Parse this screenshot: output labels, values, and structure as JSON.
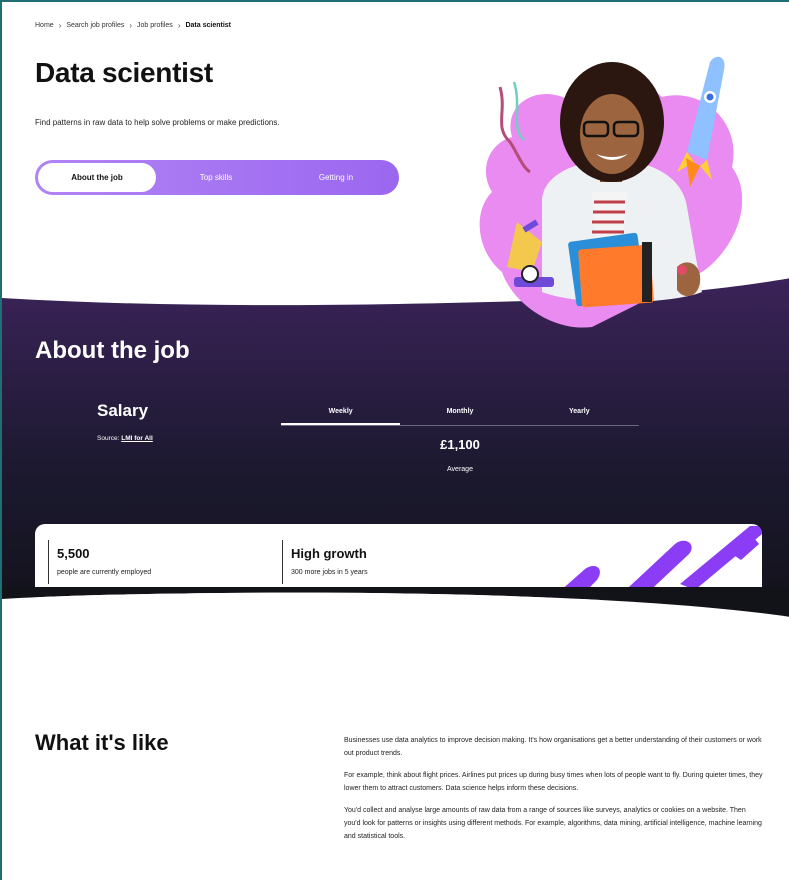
{
  "breadcrumb": {
    "items": [
      "Home",
      "Search job profiles",
      "Job profiles"
    ],
    "current": "Data scientist"
  },
  "page": {
    "title": "Data scientist",
    "subtitle": "Find patterns in raw data to help solve problems or make predictions."
  },
  "tabs": [
    "About the job",
    "Top skills",
    "Getting in"
  ],
  "about": {
    "title": "About the job",
    "salary_title": "Salary",
    "source_label": "Source:",
    "source_link": "LMI for All",
    "salary_tabs": [
      "Weekly",
      "Monthly",
      "Yearly"
    ],
    "amount": "£1,100",
    "amount_label": "Average"
  },
  "stats": [
    {
      "value": "5,500",
      "desc": "people are currently employed"
    },
    {
      "value": "High growth",
      "desc": "300 more jobs in 5 years"
    }
  ],
  "like": {
    "title": "What it's like",
    "paragraphs": [
      "Businesses use data analytics to improve decision making. It's how organisations get a better understanding of their customers or work out product trends.",
      "For example, think about flight prices. Airlines put prices up during busy times when lots of people want to fly. During quieter times, they lower them to attract customers. Data science helps inform these decisions.",
      "You'd collect and analyse large amounts of raw data from a range of sources like surveys, analytics or cookies on a website. Then you'd look for patterns or insights using different methods. For example, algorithms, data mining, artificial intelligence, machine learning and statistical tools."
    ]
  },
  "colors": {
    "purple_tab": "#a777f3",
    "dark_top": "#3a2358",
    "dark_bottom": "#15151f",
    "pink_blob": "#e98bf0",
    "accent_purple": "#8b3cf5"
  }
}
